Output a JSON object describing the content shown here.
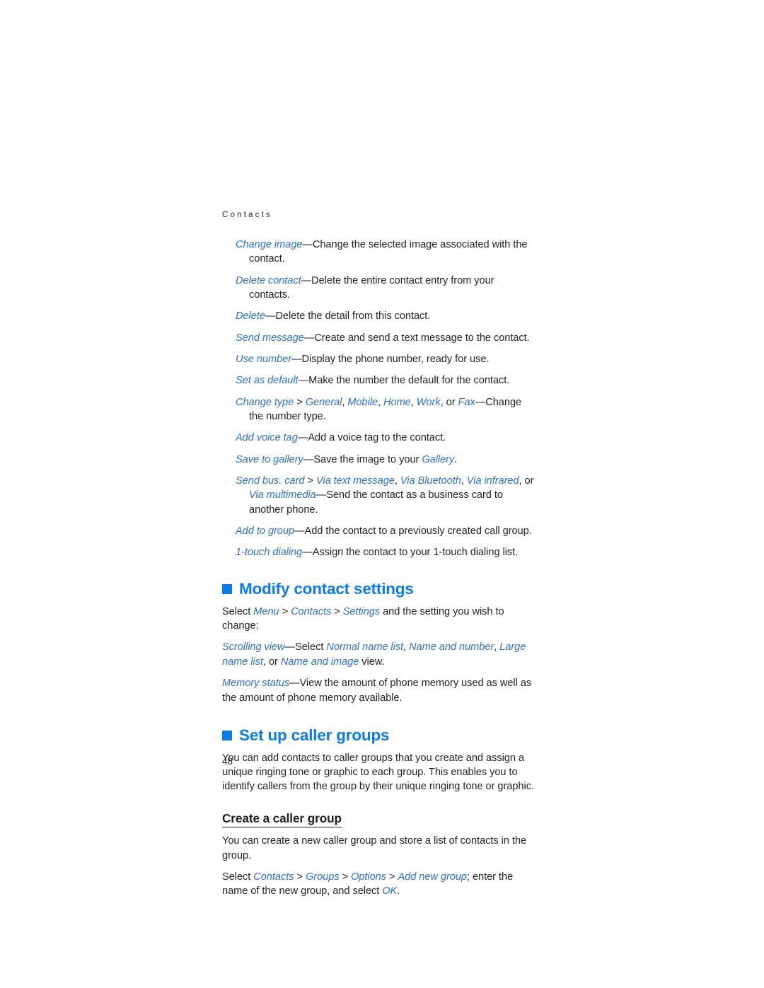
{
  "document": {
    "running_header": "Contacts",
    "page_number": "48",
    "accent_blue": "#0b7bea",
    "reference_blue": "#2b6fd4",
    "text_color": "#231f20"
  },
  "options_list": [
    {
      "ref": "Change image",
      "dash": "—",
      "text": "Change the selected image associated with the contact."
    },
    {
      "ref": "Delete contact",
      "dash": "—",
      "text": "Delete the entire contact entry from your contacts."
    },
    {
      "ref": "Delete",
      "dash": "—",
      "text": "Delete the detail from this contact."
    },
    {
      "ref": "Send message",
      "dash": "—",
      "text": "Create and send a text message to the contact."
    },
    {
      "ref": "Use number",
      "dash": "—",
      "text": "Display the phone number, ready for use."
    },
    {
      "ref": "Set as default",
      "dash": "—",
      "text": "Make the number the default for the contact."
    }
  ],
  "change_type": {
    "ref": "Change type",
    "gt": " > ",
    "opt1": "General",
    "opt2": "Mobile",
    "opt3": "Home",
    "opt4": "Work",
    "or": ", or ",
    "opt5": "Fax",
    "dash": "—",
    "text": "Change the number type."
  },
  "add_voice_tag": {
    "ref": "Add voice tag",
    "dash": "—",
    "text": "Add a voice tag to the contact."
  },
  "save_to_gallery": {
    "ref": "Save to gallery",
    "dash": "—",
    "text": "Save the image to your ",
    "gallery": "Gallery",
    "period": "."
  },
  "send_bus_card": {
    "ref": "Send bus. card",
    "gt": " > ",
    "opt1": "Via text message",
    "opt2": "Via Bluetooth",
    "opt3": "Via infrared",
    "or": ", or ",
    "opt4": "Via multimedia",
    "dash": "—",
    "text": "Send the contact as a business card to another phone."
  },
  "add_to_group": {
    "ref": "Add to group",
    "dash": "—",
    "text": "Add the contact to a previously created call group."
  },
  "one_touch_dialing": {
    "ref": "1-touch dialing",
    "dash": "—",
    "text": "Assign the contact to your 1-touch dialing list."
  },
  "modify_contact_settings": {
    "heading": "Modify contact settings",
    "intro_lead": "Select ",
    "intro_menu": "Menu",
    "gt1": " > ",
    "intro_contacts": "Contacts",
    "gt2": " > ",
    "intro_settings": "Settings",
    "intro_tail": " and the setting you wish to change:",
    "scrolling_view": {
      "ref": "Scrolling view",
      "dash": "—",
      "select": "Select ",
      "opt1": "Normal name list",
      "opt2": "Name and number",
      "opt3": "Large name list",
      "or": ", or ",
      "opt4": "Name and image",
      "tail": " view."
    },
    "memory_status": {
      "ref": "Memory status",
      "dash": "—",
      "text": "View the amount of phone memory used as well as the amount of phone memory available."
    }
  },
  "set_up_caller_groups": {
    "heading": "Set up caller groups",
    "intro": "You can add contacts to caller groups that you create and assign a unique ringing tone or graphic to each group. This enables you to identify callers from the group by their unique ringing tone or graphic.",
    "subheading": "Create a caller group",
    "sub_intro": "You can create a new caller group and store a list of contacts in the group.",
    "steps": {
      "lead": "Select ",
      "contacts": "Contacts",
      "gt1": " > ",
      "groups": "Groups",
      "gt2": " > ",
      "options": "Options",
      "gt3": " > ",
      "add_new_group": "Add new group",
      "mid": "; enter the name of the new group, and select ",
      "ok": "OK",
      "period": "."
    }
  }
}
